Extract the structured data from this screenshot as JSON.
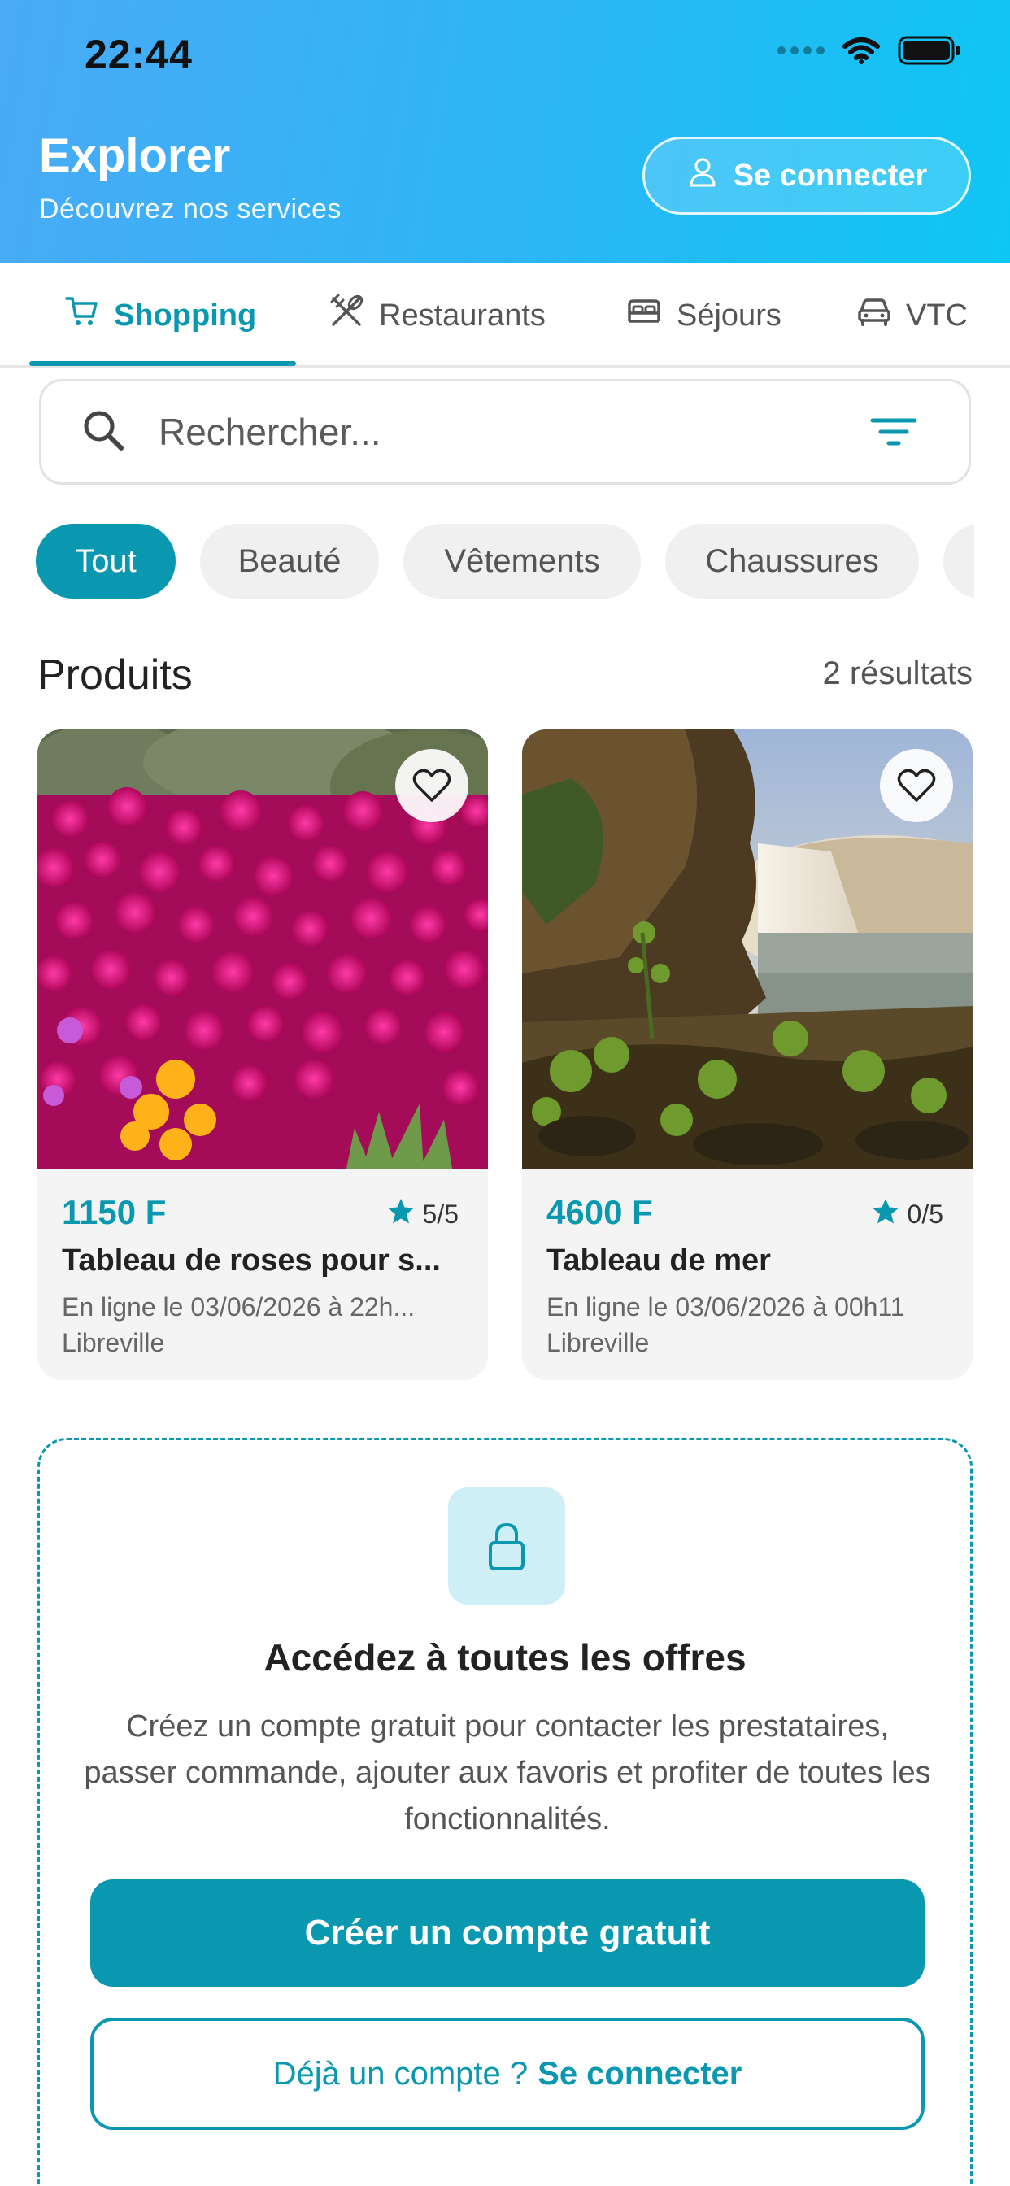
{
  "status_bar": {
    "time": "22:44"
  },
  "header": {
    "title": "Explorer",
    "subtitle": "Découvrez nos services",
    "login_label": "Se connecter"
  },
  "tabs": [
    {
      "label": "Shopping",
      "icon": "cart-icon",
      "active": true
    },
    {
      "label": "Restaurants",
      "icon": "utensils-icon",
      "active": false
    },
    {
      "label": "Séjours",
      "icon": "bed-icon",
      "active": false
    },
    {
      "label": "VTC",
      "icon": "car-icon",
      "active": false
    }
  ],
  "search": {
    "placeholder": "Rechercher..."
  },
  "categories": [
    "Tout",
    "Beauté",
    "Vêtements",
    "Chaussures"
  ],
  "section": {
    "title": "Produits",
    "count": "2 résultats"
  },
  "products": [
    {
      "price": "1150 F",
      "rating": "5/5",
      "title": "Tableau de roses pour s...",
      "date": "En ligne le 03/06/2026 à 22h...",
      "city": "Libreville"
    },
    {
      "price": "4600 F",
      "rating": "0/5",
      "title": "Tableau de mer",
      "date": "En ligne le 03/06/2026 à 00h11",
      "city": "Libreville"
    }
  ],
  "promo": {
    "title": "Accédez à toutes les offres",
    "text": "Créez un compte gratuit pour contacter les prestataires, passer commande, ajouter aux favoris et profiter de toutes les fonctionnalités.",
    "primary_label": "Créer un compte gratuit",
    "secondary_prefix": "Déjà un compte ?",
    "secondary_link": "Se connecter"
  },
  "colors": {
    "accent": "#0a97b0",
    "header_start": "#4aaaf6",
    "header_end": "#0ec6f4"
  }
}
